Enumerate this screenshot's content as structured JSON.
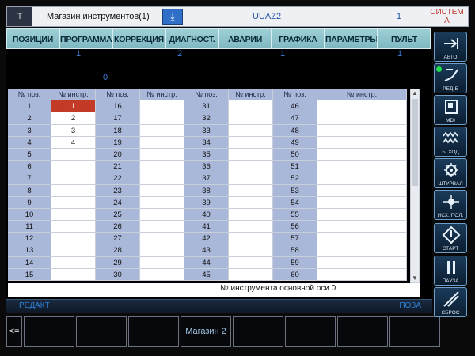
{
  "titlebar": {
    "logo": "T",
    "title": "Магазин инструментов(1)",
    "download_icon": "download-icon",
    "program": "UUAZ2",
    "number": "1",
    "system": "СИСТЕМ\nА"
  },
  "menu": [
    "ПОЗИЦИИ",
    "ПРОГРАММА",
    "КОРРЕКЦИЯ",
    "ДИАГНОСТ.",
    "АВАРИИ",
    "ГРАФИКА",
    "ПАРАМЕТРЫ",
    "ПУЛЬТ"
  ],
  "badges": {
    "programma": "1",
    "diagnost": "2",
    "grafika": "1",
    "pult": "1",
    "left": "0"
  },
  "table": {
    "headers": [
      "№ поз.",
      "№ инстр.",
      "№ поз.",
      "№ инстр.",
      "№ поз.",
      "№ инстр.",
      "№ поз.",
      "№ инстр."
    ],
    "rows": [
      [
        "1",
        "1",
        "16",
        "",
        "31",
        "",
        "46",
        ""
      ],
      [
        "2",
        "2",
        "17",
        "",
        "32",
        "",
        "47",
        ""
      ],
      [
        "3",
        "3",
        "18",
        "",
        "33",
        "",
        "48",
        ""
      ],
      [
        "4",
        "4",
        "19",
        "",
        "34",
        "",
        "49",
        ""
      ],
      [
        "5",
        "",
        "20",
        "",
        "35",
        "",
        "50",
        ""
      ],
      [
        "6",
        "",
        "21",
        "",
        "36",
        "",
        "51",
        ""
      ],
      [
        "7",
        "",
        "22",
        "",
        "37",
        "",
        "52",
        ""
      ],
      [
        "8",
        "",
        "23",
        "",
        "38",
        "",
        "53",
        ""
      ],
      [
        "9",
        "",
        "24",
        "",
        "39",
        "",
        "54",
        ""
      ],
      [
        "10",
        "",
        "25",
        "",
        "40",
        "",
        "55",
        ""
      ],
      [
        "11",
        "",
        "26",
        "",
        "41",
        "",
        "56",
        ""
      ],
      [
        "12",
        "",
        "27",
        "",
        "42",
        "",
        "57",
        ""
      ],
      [
        "13",
        "",
        "28",
        "",
        "43",
        "",
        "58",
        ""
      ],
      [
        "14",
        "",
        "29",
        "",
        "44",
        "",
        "59",
        ""
      ],
      [
        "15",
        "",
        "30",
        "",
        "45",
        "",
        "60",
        ""
      ]
    ],
    "selected_row": 0,
    "selected_col": 1
  },
  "axis_label": "№ инструмента основной оси  0",
  "strip": {
    "left": "РЕДАКТ",
    "right": "ПОЗА"
  },
  "softkeys": {
    "back": "<=",
    "labels": [
      "",
      "",
      "",
      "Магазин 2",
      "",
      "",
      "",
      ""
    ]
  },
  "sidebar": [
    {
      "name": "avto",
      "label": "АВТО",
      "icon": "auto-icon"
    },
    {
      "name": "red",
      "label": "РЕД-Е",
      "icon": "edit-icon",
      "active": true
    },
    {
      "name": "mdi",
      "label": "MDI",
      "icon": "mdi-icon"
    },
    {
      "name": "bhod",
      "label": "Б. ХОД",
      "icon": "fast-move-icon"
    },
    {
      "name": "shturval",
      "label": "ШТУРВАЛ",
      "icon": "handwheel-icon"
    },
    {
      "name": "iskhpol",
      "label": "ИСХ. ПОЛ.",
      "icon": "home-position-icon"
    },
    {
      "name": "start",
      "label": "СТАРТ",
      "icon": "start-icon"
    },
    {
      "name": "pauza",
      "label": "ПАУЗА",
      "icon": "pause-icon"
    },
    {
      "name": "sbros",
      "label": "СБРОС",
      "icon": "reset-icon"
    }
  ],
  "colors": {
    "accent": "#2f7fd6",
    "selected_cell": "#c33a26",
    "header": "#a9b7d8",
    "active_led": "#1ee04a"
  }
}
